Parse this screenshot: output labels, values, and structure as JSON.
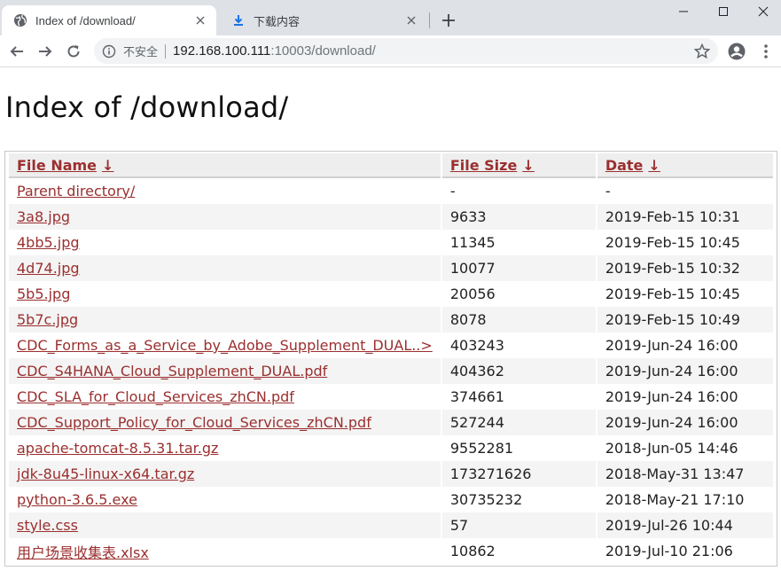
{
  "browser": {
    "tabs": [
      {
        "title": "Index of /download/",
        "icon": "globe-icon",
        "active": true
      },
      {
        "title": "下载内容",
        "icon": "download-icon",
        "active": false
      }
    ],
    "new_tab_label": "+",
    "omnibox": {
      "security_label": "不安全",
      "host": "192.168.100.111",
      "path": ":10003/download/"
    }
  },
  "page": {
    "title": "Index of /download/",
    "columns": [
      {
        "label": "File Name",
        "sort": "↓"
      },
      {
        "label": "File Size",
        "sort": "↓"
      },
      {
        "label": "Date",
        "sort": "↓"
      }
    ],
    "rows": [
      {
        "name": "Parent directory/",
        "size": "-",
        "date": "-"
      },
      {
        "name": "3a8.jpg",
        "size": "9633",
        "date": "2019-Feb-15 10:31"
      },
      {
        "name": "4bb5.jpg",
        "size": "11345",
        "date": "2019-Feb-15 10:45"
      },
      {
        "name": "4d74.jpg",
        "size": "10077",
        "date": "2019-Feb-15 10:32"
      },
      {
        "name": "5b5.jpg",
        "size": "20056",
        "date": "2019-Feb-15 10:45"
      },
      {
        "name": "5b7c.jpg",
        "size": "8078",
        "date": "2019-Feb-15 10:49"
      },
      {
        "name": "CDC_Forms_as_a_Service_by_Adobe_Supplement_DUAL..>",
        "size": "403243",
        "date": "2019-Jun-24 16:00"
      },
      {
        "name": "CDC_S4HANA_Cloud_Supplement_DUAL.pdf",
        "size": "404362",
        "date": "2019-Jun-24 16:00"
      },
      {
        "name": "CDC_SLA_for_Cloud_Services_zhCN.pdf",
        "size": "374661",
        "date": "2019-Jun-24 16:00"
      },
      {
        "name": "CDC_Support_Policy_for_Cloud_Services_zhCN.pdf",
        "size": "527244",
        "date": "2019-Jun-24 16:00"
      },
      {
        "name": "apache-tomcat-8.5.31.tar.gz",
        "size": "9552281",
        "date": "2018-Jun-05 14:46"
      },
      {
        "name": "jdk-8u45-linux-x64.tar.gz",
        "size": "173271626",
        "date": "2018-May-31 13:47"
      },
      {
        "name": "python-3.6.5.exe",
        "size": "30735232",
        "date": "2018-May-21 17:10"
      },
      {
        "name": "style.css",
        "size": "57",
        "date": "2019-Jul-26 10:44"
      },
      {
        "name": "用户场景收集表.xlsx",
        "size": "10862",
        "date": "2019-Jul-10 21:06"
      }
    ]
  },
  "colors": {
    "link": "#9b2f2f",
    "tabstrip": "#dee1e6",
    "omnibox": "#f1f3f4"
  }
}
